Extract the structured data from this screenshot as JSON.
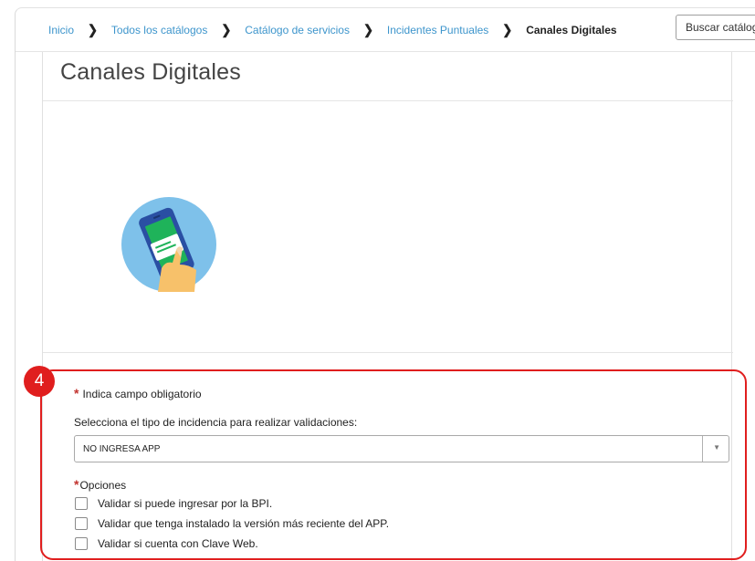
{
  "breadcrumb": {
    "items": [
      "Inicio",
      "Todos los catálogos",
      "Catálogo de servicios",
      "Incidentes Puntuales"
    ],
    "current": "Canales Digitales",
    "separator": "❯"
  },
  "search": {
    "placeholder": "Buscar catálogo"
  },
  "card": {
    "title": "Canales Digitales"
  },
  "annotation": {
    "step": "4"
  },
  "form": {
    "required_star": "*",
    "required_note": "Indica campo obligatorio",
    "incident_label": "Selecciona el tipo de incidencia para realizar validaciones:",
    "incident_value": "NO INGRESA APP",
    "options_label": "Opciones",
    "options": [
      "Validar si puede ingresar por la BPI.",
      "Validar que tenga instalado la versión más reciente del APP.",
      "Validar si cuenta con Clave Web."
    ]
  },
  "colors": {
    "link": "#3d95cc",
    "highlight": "#e01e1e",
    "required": "#c2332f",
    "icon_circle": "#7ec1ea",
    "phone": "#2a4fa3",
    "screen": "#1fb35a"
  },
  "icons": {
    "hero": "mobile-phone-hand-icon",
    "select_arrow": "caret-down-icon"
  }
}
